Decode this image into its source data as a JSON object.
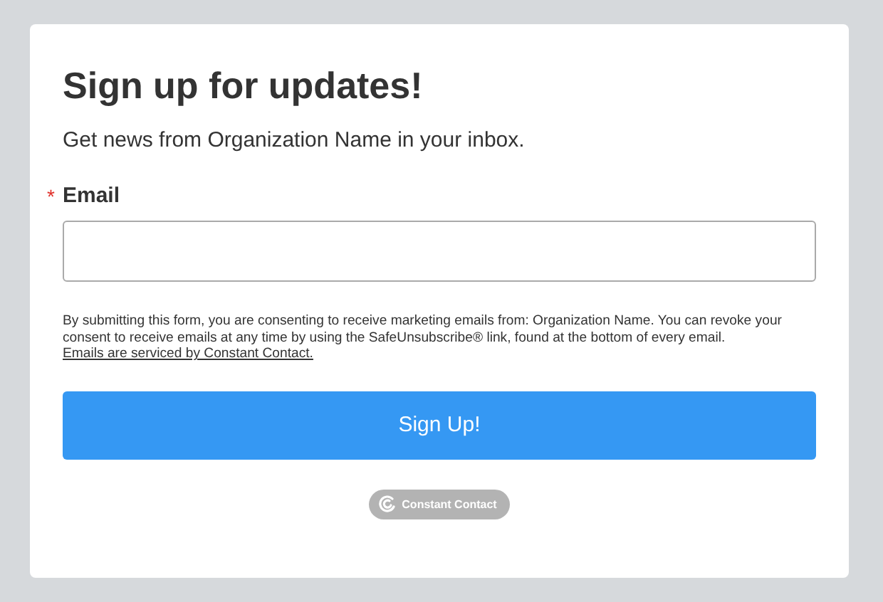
{
  "title": "Sign up for updates!",
  "subtitle": "Get news from Organization Name in your inbox.",
  "email_field": {
    "label": "Email",
    "required": true,
    "required_mark": "*"
  },
  "consent": {
    "text": "By submitting this form, you are consenting to receive marketing emails from: Organization Name. You can revoke your consent to receive emails at any time by using the SafeUnsubscribe® link, found at the bottom of every email.",
    "link": "Emails are serviced by Constant Contact."
  },
  "submit_button": "Sign Up!",
  "badge": "Constant Contact"
}
